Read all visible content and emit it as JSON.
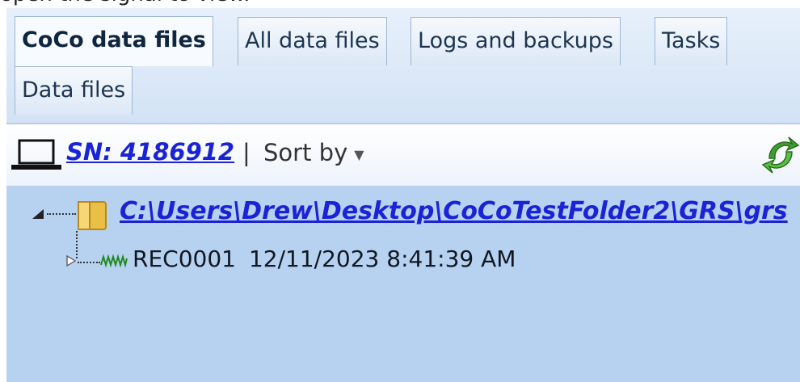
{
  "caption": "open the signal to view.",
  "tabs": {
    "row1": [
      {
        "label": "CoCo data files",
        "active": true
      },
      {
        "label": "All data files",
        "active": false
      },
      {
        "label": "Logs and backups",
        "active": false
      },
      {
        "label": "Tasks",
        "active": false
      }
    ],
    "row2": [
      {
        "label": "Data files",
        "active": false
      }
    ]
  },
  "toolbar": {
    "device_icon": "laptop-icon",
    "serial_link": "SN: 4186912",
    "separator": "|",
    "sort_label": "Sort by",
    "refresh_icon": "refresh-icon"
  },
  "tree": {
    "root": {
      "expanded": true,
      "icon": "folder-icon",
      "path": "C:\\Users\\Drew\\Desktop\\CoCoTestFolder2\\GRS\\grs"
    },
    "children": [
      {
        "icon": "signal-icon",
        "name": "REC0001",
        "datetime": "12/11/2023 8:41:39 AM",
        "expanded": false
      }
    ]
  },
  "colors": {
    "tree_background": "#b7d1f1",
    "link": "#1a23d6"
  }
}
